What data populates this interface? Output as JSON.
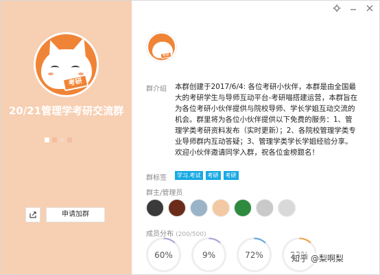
{
  "left": {
    "group_name": "20/21管理学考研交流群",
    "avatar_badge": "考研",
    "dot_colors": [
      "#ffffff",
      "#f3bda0",
      "#f6d6c0",
      "#f3bfa4"
    ],
    "share_icon": "share-icon",
    "join_label": "申请加群"
  },
  "titlebar": {
    "icons": [
      "settings-icon",
      "minimize-icon",
      "close-icon"
    ]
  },
  "right": {
    "avatar_badge": "考研",
    "intro_label": "群介绍",
    "intro_text": "本群创建于2017/6/4: 各位考研小伙伴，本群是由全国最大的考研学生与导师互动平台-考研喵搭建运营，本群旨在为各位考研小伙伴提供与院校导师、学长学姐互动交流的机会。群里将为各位小伙伴提供以下免费的服务：1、管理学类考研资料发布（实时更新）；2、各院校管理学类专业导师群内互动答疑；3、管理学类学长学姐经验分享。欢迎小伙伴邀请同学入群，祝各位金榜题名！",
    "tags_label": "群标签",
    "tags": [
      "学习.考试",
      "考研",
      "考研"
    ],
    "admins_label": "群主/管理员",
    "admin_colors": [
      "#3a3a3a",
      "#6b2c1c",
      "#9ab3c6",
      "#f3c9a3",
      "#2d8a3e",
      "#c9c9c9",
      "#d9d9d9"
    ],
    "members_label": "成员分布",
    "members_count": "(200/500)",
    "stats": [
      {
        "label": "60%",
        "value": 60
      },
      {
        "label": "9%",
        "value": 9
      },
      {
        "label": "72%",
        "value": 72
      },
      {
        "label": "23%",
        "value": 23
      }
    ],
    "accent": "#17a9e3",
    "stat_arc_colors": [
      "#a9a4d8",
      "#a9a4d8",
      "#5aa8e6",
      "#f3a24a"
    ]
  },
  "watermark": "知乎 @梨啊梨"
}
